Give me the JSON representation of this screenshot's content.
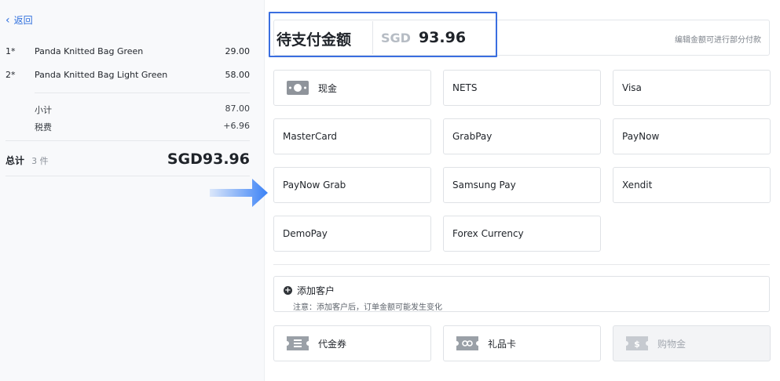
{
  "back_label": "返回",
  "order": {
    "items": [
      {
        "qty": "1*",
        "name": "Panda Knitted Bag Green",
        "price": "29.00"
      },
      {
        "qty": "2*",
        "name": "Panda Knitted Bag Light Green",
        "price": "58.00"
      }
    ],
    "subtotal_label": "小计",
    "subtotal_value": "87.00",
    "tax_label": "税费",
    "tax_value": "+6.96",
    "total_label": "总计",
    "total_count": "3 件",
    "total_value": "SGD93.96"
  },
  "payment": {
    "due_label": "待支付金额",
    "currency": "SGD",
    "amount": "93.96",
    "partial_hint": "编辑金额可进行部分付款",
    "methods": [
      {
        "label": "现金",
        "icon": "cash-icon"
      },
      {
        "label": "NETS"
      },
      {
        "label": "Visa"
      },
      {
        "label": "MasterCard"
      },
      {
        "label": "GrabPay"
      },
      {
        "label": "PayNow"
      },
      {
        "label": "PayNow Grab"
      },
      {
        "label": "Samsung Pay"
      },
      {
        "label": "Xendit"
      },
      {
        "label": "DemoPay"
      },
      {
        "label": "Forex Currency"
      }
    ],
    "add_customer_label": "添加客户",
    "add_customer_note": "注意：添加客户后，订单金额可能发生变化",
    "extras": [
      {
        "label": "代金券",
        "icon": "voucher-icon"
      },
      {
        "label": "礼品卡",
        "icon": "gift-card-icon"
      },
      {
        "label": "购物金",
        "icon": "store-credit-icon",
        "disabled": true
      }
    ]
  },
  "colors": {
    "accent": "#2f6fdd",
    "highlight": "#3a6ee0",
    "arrow": "#3b82f6"
  }
}
